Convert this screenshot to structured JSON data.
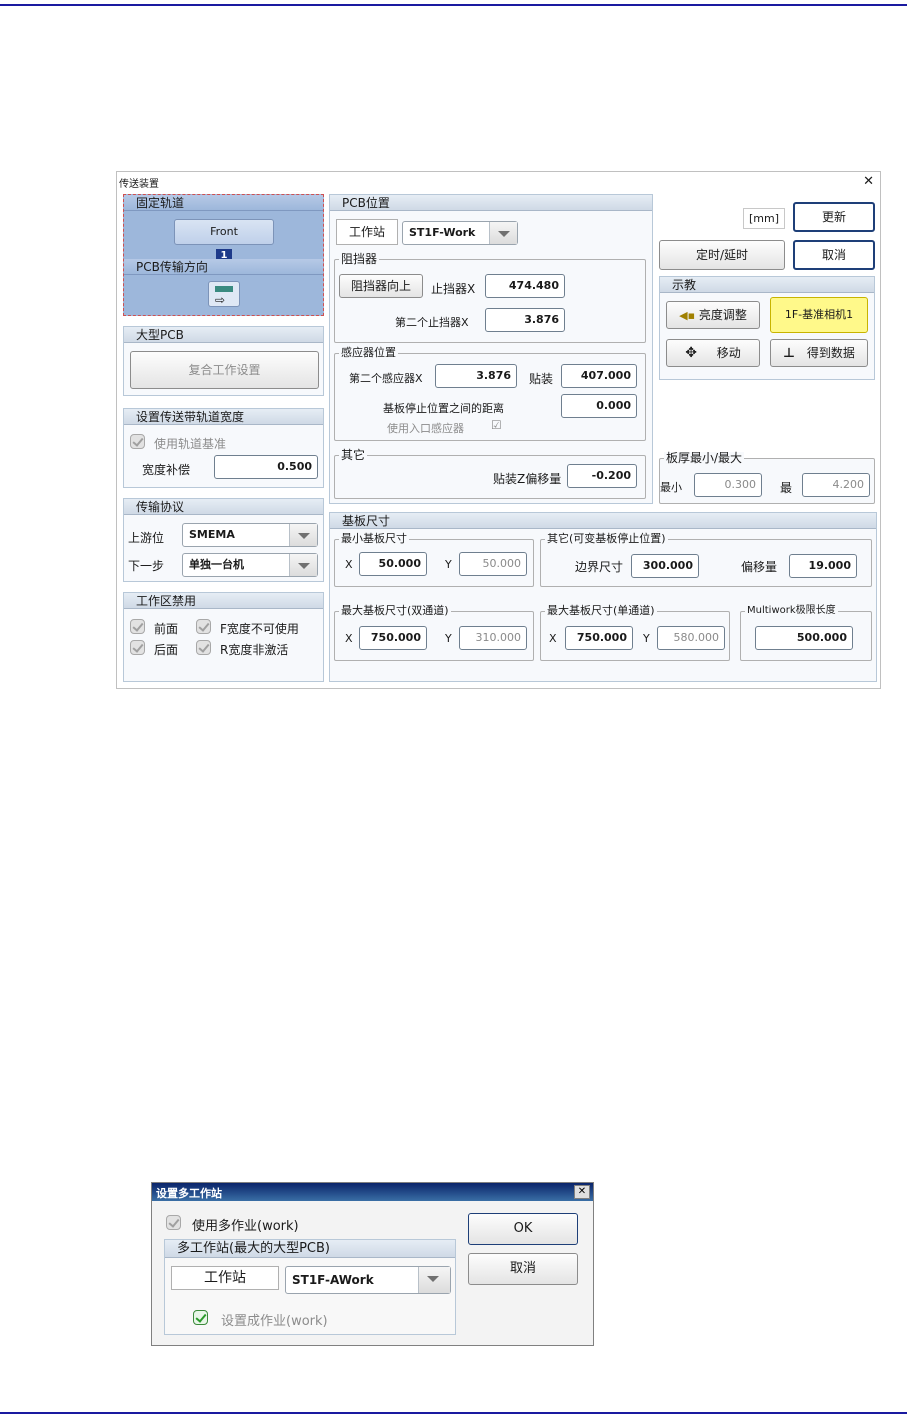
{
  "conveyor": {
    "window_title": "传送装置",
    "close_glyph": "✕",
    "fixed_rail": {
      "header": "固定轨道",
      "front_label": "Front",
      "badge": "1"
    },
    "pcb_direction": {
      "header": "PCB传输方向"
    },
    "large_pcb": {
      "header": "大型PCB",
      "button": "复合工作设置"
    },
    "rail_width": {
      "header": "设置传送带轨道宽度",
      "use_rail_ref": "使用轨道基准",
      "width_comp_label": "宽度补偿",
      "width_comp_value": "0.500"
    },
    "transfer_protocol": {
      "header": "传输协议",
      "upstream_label": "上游位",
      "upstream_value": "SMEMA",
      "next_label": "下一步",
      "next_value": "单独一台机"
    },
    "workzone_disable": {
      "header": "工作区禁用",
      "front": "前面",
      "rear": "后面",
      "f_width": "F宽度不可使用",
      "r_width": "R宽度非激活"
    },
    "pcb_position": {
      "header": "PCB位置",
      "station_tab": "工作站",
      "station_value": "ST1F-Work",
      "stopper": {
        "legend": "阻挡器",
        "up_button": "阻挡器向上",
        "stopper_x_label": "止挡器X",
        "stopper_x_value": "474.480",
        "second_stopper_x_label": "第二个止挡器X",
        "second_stopper_x_value": "3.876"
      },
      "sensor": {
        "legend": "感应器位置",
        "second_sensor_x_label": "第二个感应器X",
        "second_sensor_x_value": "3.876",
        "mount_label": "贴装",
        "mount_value": "407.000",
        "distance_label": "基板停止位置之间的距离",
        "distance_value": "0.000",
        "use_entry_sensor": "使用入口感应器",
        "check_glyph": "☑"
      },
      "other": {
        "legend": "其它",
        "z_offset_label": "贴装Z偏移量",
        "z_offset_value": "-0.200"
      }
    },
    "right": {
      "unit": "[mm]",
      "update_button": "更新",
      "timer_button": "定时/延时",
      "cancel_button": "取消",
      "teach": {
        "header": "示教",
        "brightness_button": "亮度调整",
        "camera_button": "1F-基准相机1",
        "move_button": "移动",
        "get_data_button": "得到数据"
      },
      "thickness": {
        "legend": "板厚最小/最大",
        "min_label": "最小",
        "min_value": "0.300",
        "max_label": "最",
        "max_value": "4.200"
      }
    },
    "board_size": {
      "header": "基板尺寸",
      "min_board": {
        "legend": "最小基板尺寸",
        "x_label": "X",
        "x_value": "50.000",
        "y_label": "Y",
        "y_value": "50.000"
      },
      "other": {
        "legend": "其它(可变基板停止位置)",
        "border_label": "边界尺寸",
        "border_value": "300.000",
        "offset_label": "偏移量",
        "offset_value": "19.000"
      },
      "max_dual": {
        "legend": "最大基板尺寸(双通道)",
        "x_label": "X",
        "x_value": "750.000",
        "y_label": "Y",
        "y_value": "310.000"
      },
      "max_single": {
        "legend": "最大基板尺寸(单通道)",
        "x_label": "X",
        "x_value": "750.000",
        "y_label": "Y",
        "y_value": "580.000"
      },
      "multiwork": {
        "legend": "Multiwork极限长度",
        "value": "500.000"
      }
    }
  },
  "multistation": {
    "window_title": "设置多工作站",
    "close_glyph": "✕",
    "use_multi_work": "使用多作业(work)",
    "group_header": "多工作站(最大的大型PCB)",
    "station_tab": "工作站",
    "station_value": "ST1F-AWork",
    "set_as_work": "设置成作业(work)",
    "ok_button": "OK",
    "cancel_button": "取消"
  }
}
